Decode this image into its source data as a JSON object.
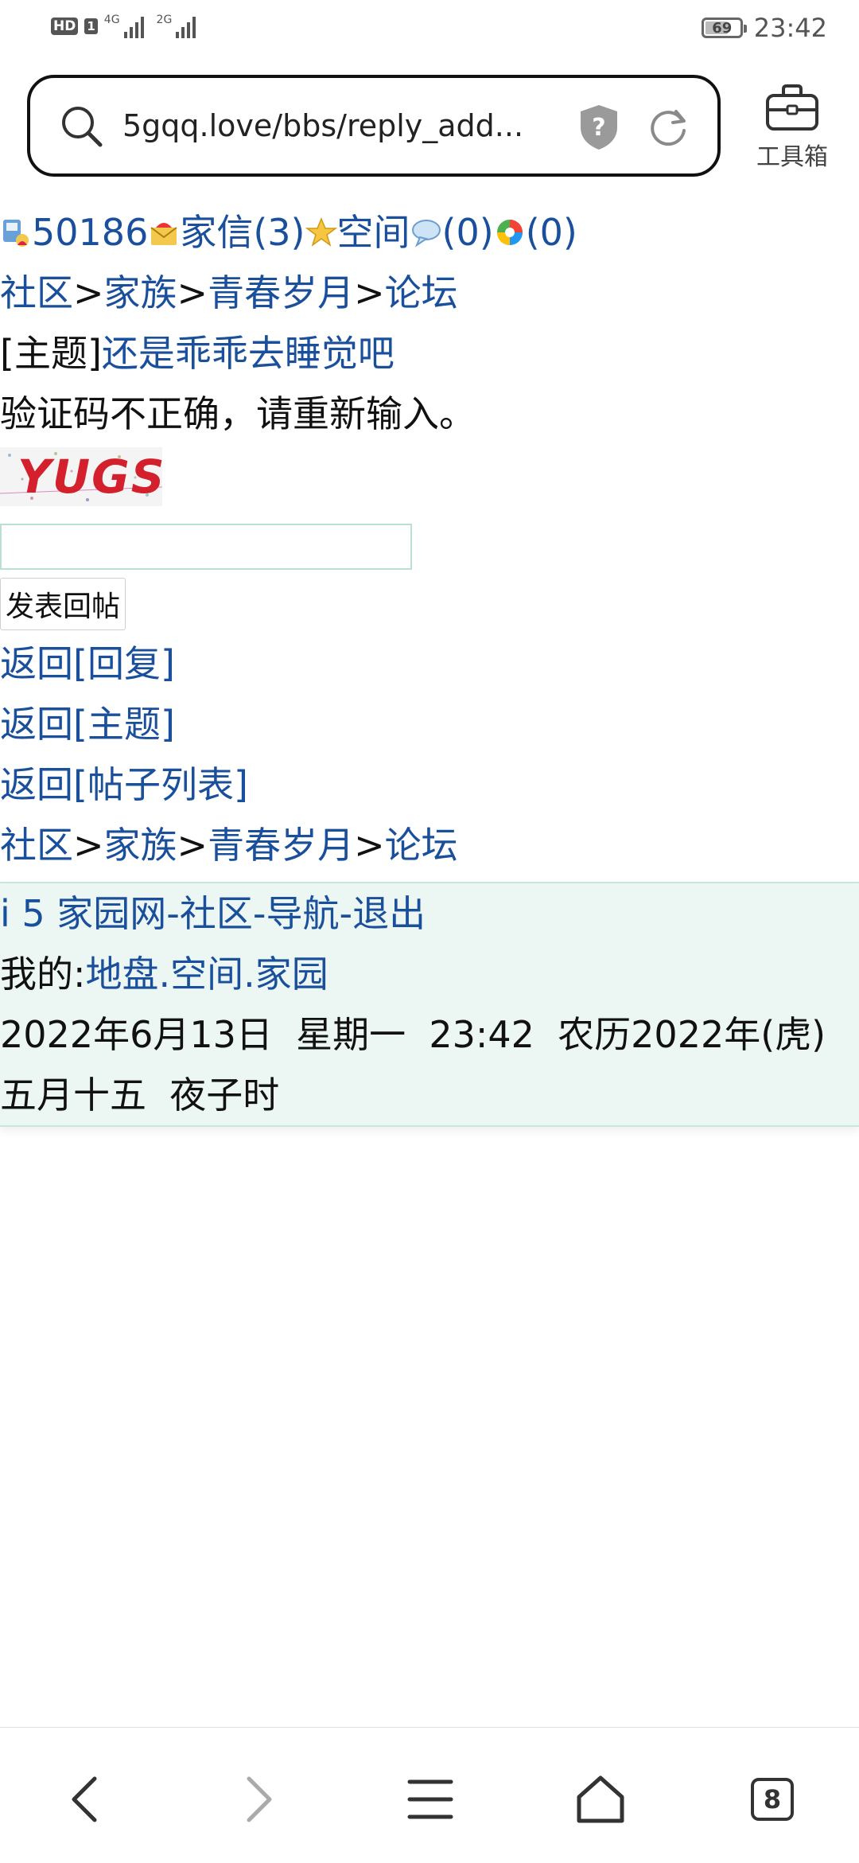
{
  "status_bar": {
    "hd": "HD",
    "sim": "1",
    "net1": "4G",
    "net2": "2G",
    "battery": "69",
    "time": "23:42"
  },
  "address_bar": {
    "url": "5gqq.love/bbs/reply_add...",
    "toolbox_label": "工具箱"
  },
  "user_bar": {
    "user_id": "50186",
    "mail_label": "家信(3)",
    "space_label": "空间",
    "chat_count": "(0)",
    "other_count": "(0)"
  },
  "breadcrumb": {
    "items": [
      "社区",
      "家族",
      "青春岁月",
      "论坛"
    ],
    "sep": ">"
  },
  "topic": {
    "prefix": "[主题]",
    "title": "还是乖乖去睡觉吧"
  },
  "error_message": "验证码不正确，请重新输入。",
  "captcha": {
    "text": "YUGS"
  },
  "form": {
    "code_value": "",
    "submit_label": "发表回帖"
  },
  "back_links": [
    "返回[回复]",
    "返回[主题]",
    "返回[帖子列表]"
  ],
  "footer": {
    "site_name": "i 5 家园网",
    "nav": [
      "社区",
      "导航",
      "退出"
    ],
    "dash": "-",
    "mine_label": "我的:",
    "mine_links": [
      "地盘",
      "空间",
      "家园"
    ],
    "dot": ".",
    "datetime": "2022年6月13日  星期一  23:42  农历2022年(虎)  五月十五  夜子时"
  },
  "nav_bar": {
    "tab_count": "8"
  },
  "colors": {
    "link": "#1a4f9c",
    "footer_bg": "#ecf6f3",
    "captcha_red": "#d4202c"
  }
}
